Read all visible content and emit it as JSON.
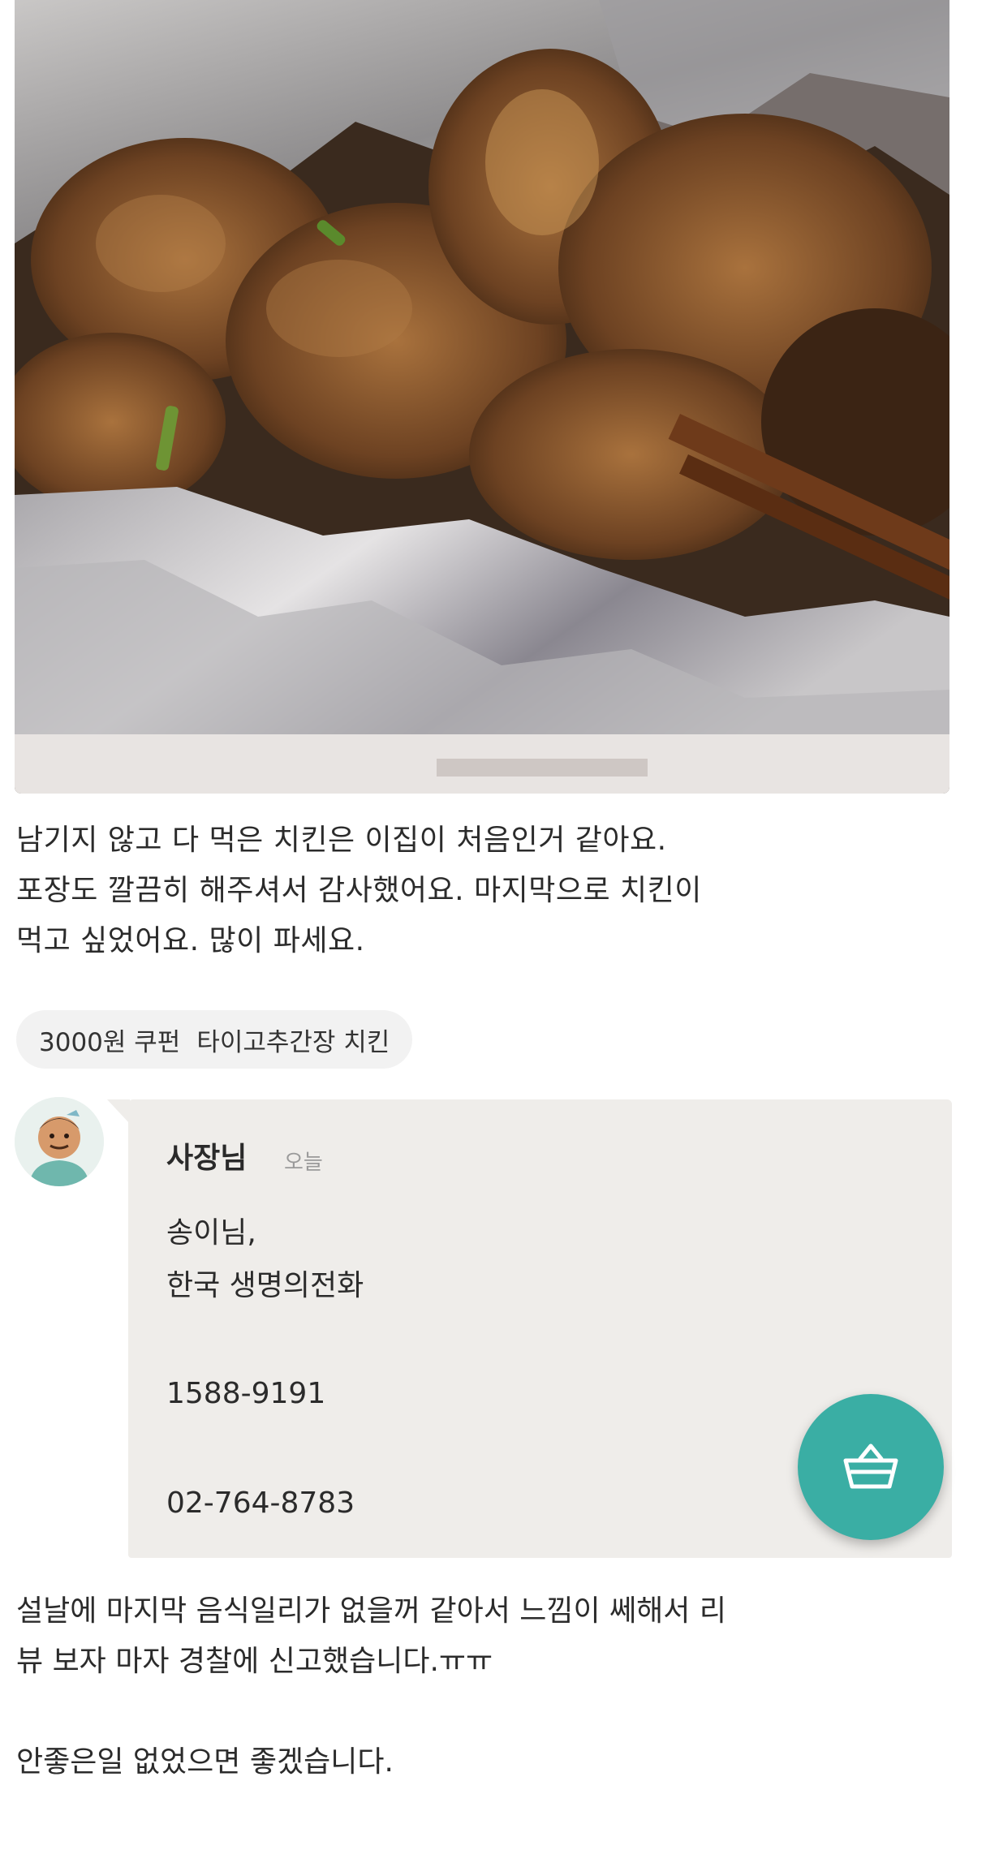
{
  "photo": {
    "description_icon": "fried-chicken-photo"
  },
  "review": {
    "lines": [
      "남기지 않고 다 먹은 치킨은 이집이 처음인거 같아요.",
      "포장도 깔끔히 해주셔서 감사했어요. 마지막으로 치킨이",
      "먹고 싶었어요. 많이 파세요."
    ],
    "tags": [
      "3000원 쿠펀",
      "타이고추간장 치킨"
    ]
  },
  "reply": {
    "author": "사장님",
    "time": "오늘",
    "lines": [
      "송이님,",
      "한국 생명의전화",
      "1588-9191",
      "02-764-8783"
    ]
  },
  "fab": {
    "icon": "basket-icon",
    "color": "#3aaea4"
  },
  "post": {
    "lines": [
      "설날에 마지막 음식일리가 없을꺼 같아서 느낌이 쎄해서 리",
      "뷰 보자 마자 경찰에 신고했습니다.ㅠㅠ",
      "",
      "안좋은일 없었으면 좋겠습니다."
    ]
  }
}
